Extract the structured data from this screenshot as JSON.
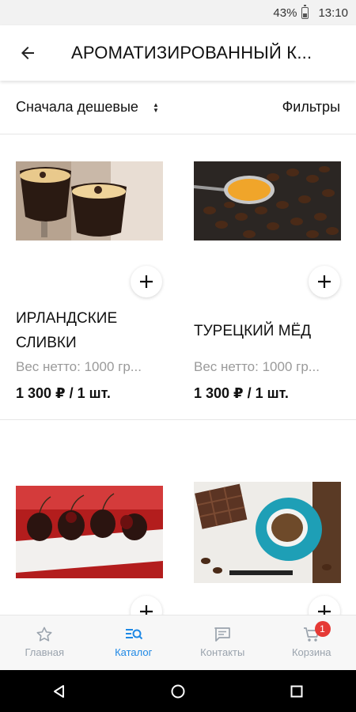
{
  "status": {
    "battery": "43%",
    "time": "13:10"
  },
  "header": {
    "title": "АРОМАТИЗИРОВАННЫЙ К..."
  },
  "sort_bar": {
    "sort_label": "Сначала дешевые",
    "filter_label": "Фильтры"
  },
  "products": [
    {
      "name": "ИРЛАНДСКИЕ СЛИВКИ",
      "weight": "Вес нетто: 1000 гр...",
      "price": "1 300 ₽ / 1 шт.",
      "image": "irish-cream-cocktail"
    },
    {
      "name": "ТУРЕЦКИЙ МЁД",
      "weight": "Вес нетто: 1000 гр...",
      "price": "1 300 ₽ / 1 шт.",
      "image": "coffee-beans-honey"
    },
    {
      "name": "",
      "weight": "",
      "price": "",
      "image": "chocolate-cherries"
    },
    {
      "name": "",
      "weight": "",
      "price": "",
      "image": "chocolate-coffee-cup"
    }
  ],
  "bottom_nav": [
    {
      "label": "Главная",
      "icon": "star-icon",
      "active": false
    },
    {
      "label": "Каталог",
      "icon": "catalog-search-icon",
      "active": true
    },
    {
      "label": "Контакты",
      "icon": "message-icon",
      "active": false
    },
    {
      "label": "Корзина",
      "icon": "cart-icon",
      "active": false,
      "badge": "1"
    }
  ],
  "colors": {
    "accent": "#1e88e5",
    "badge": "#e53935",
    "muted": "#9aa3ad"
  }
}
